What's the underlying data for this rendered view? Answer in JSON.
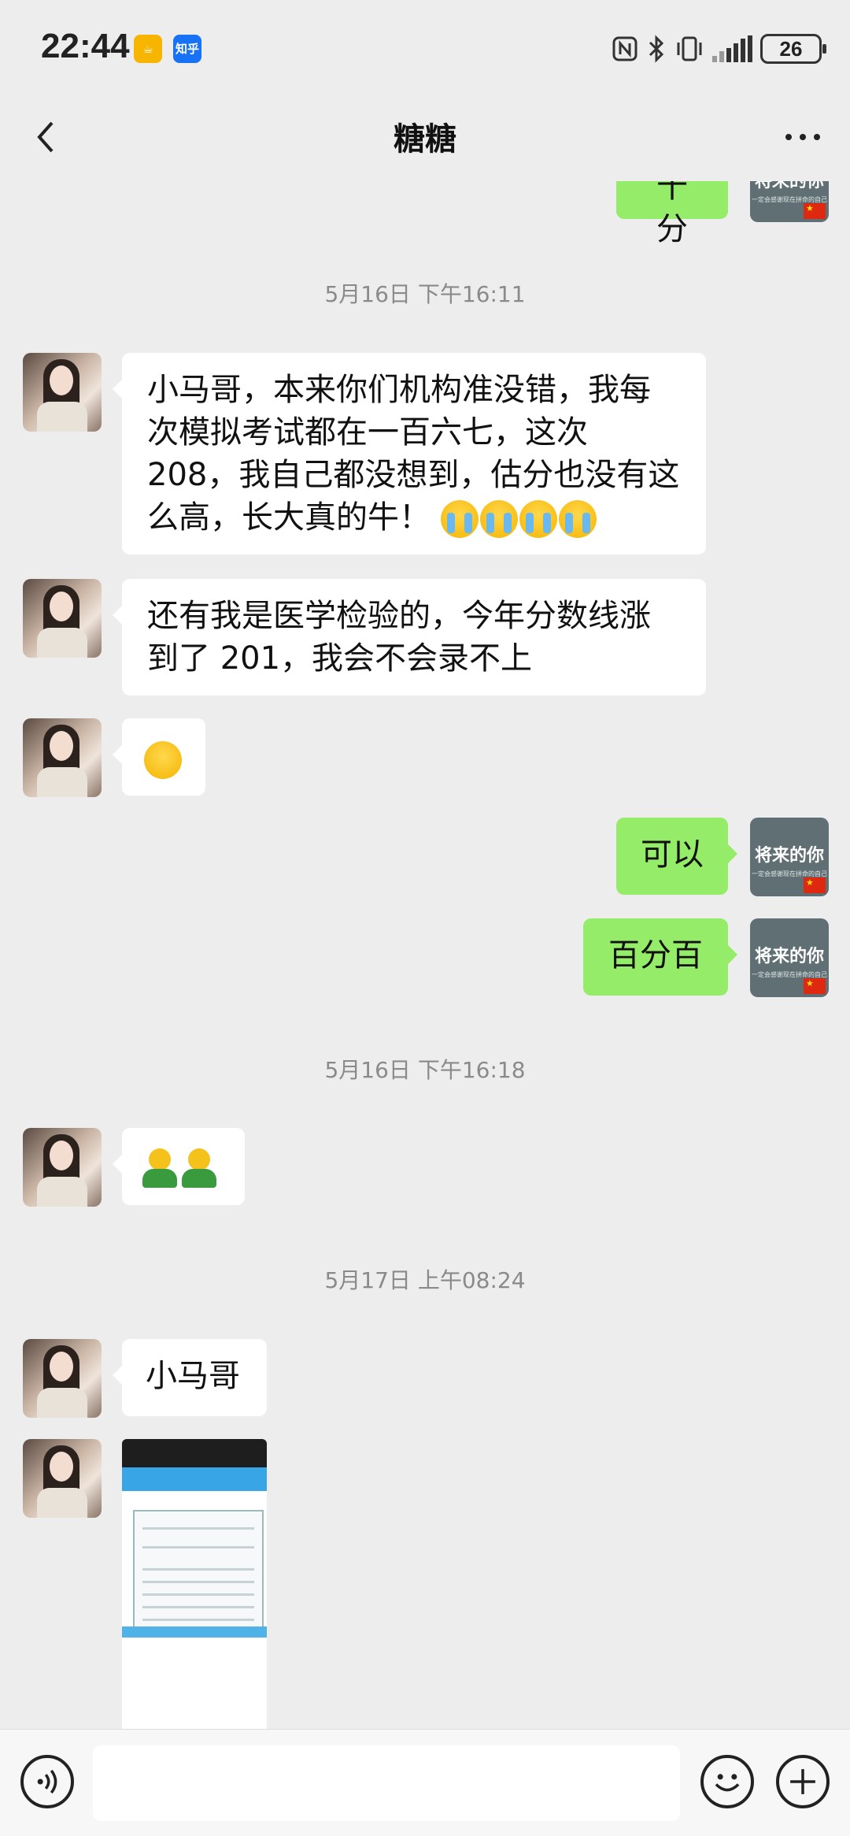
{
  "status_bar": {
    "time": "22:44",
    "app_icons": [
      "notification-app-icon",
      "zhihu-icon"
    ],
    "zhihu_label": "知乎",
    "battery": "26",
    "icons": [
      "nfc-icon",
      "bluetooth-icon",
      "vibrate-icon",
      "signal-icon",
      "battery-icon"
    ]
  },
  "nav": {
    "title": "糖糖",
    "back_icon": "back-chevron-icon",
    "more_icon": "more-dots-icon"
  },
  "avatars": {
    "me_text": "将来的你",
    "me_subtext": "一定会感谢现在拼命的自己"
  },
  "messages": {
    "partial_top": "十分",
    "ts1": "5月16日 下午16:11",
    "m1_text": "小马哥，本来你们机构准没错，我每次模拟考试都在一百六七，这次 208，我自己都没想到，估分也没有这么高，长大真的牛！",
    "m2_text": "还有我是医学检验的，今年分数线涨到了 201，我会不会录不上",
    "m3_emoji": "annoyed-emoji",
    "m4_text": "可以",
    "m5_text": "百分百",
    "ts2": "5月16日 下午16:18",
    "m6_emoji": "two-green-people-emoji",
    "ts3": "5月17日 上午08:24",
    "m7_text": "小马哥",
    "m8_image": "screenshot-thumbnail"
  },
  "input_bar": {
    "voice_icon": "voice-icon",
    "emoji_icon": "emoji-icon",
    "plus_icon": "plus-icon"
  },
  "colors": {
    "background": "#ededed",
    "bubble_right": "#95ec69",
    "bubble_left": "#ffffff",
    "timestamp": "#8a8a8a"
  }
}
